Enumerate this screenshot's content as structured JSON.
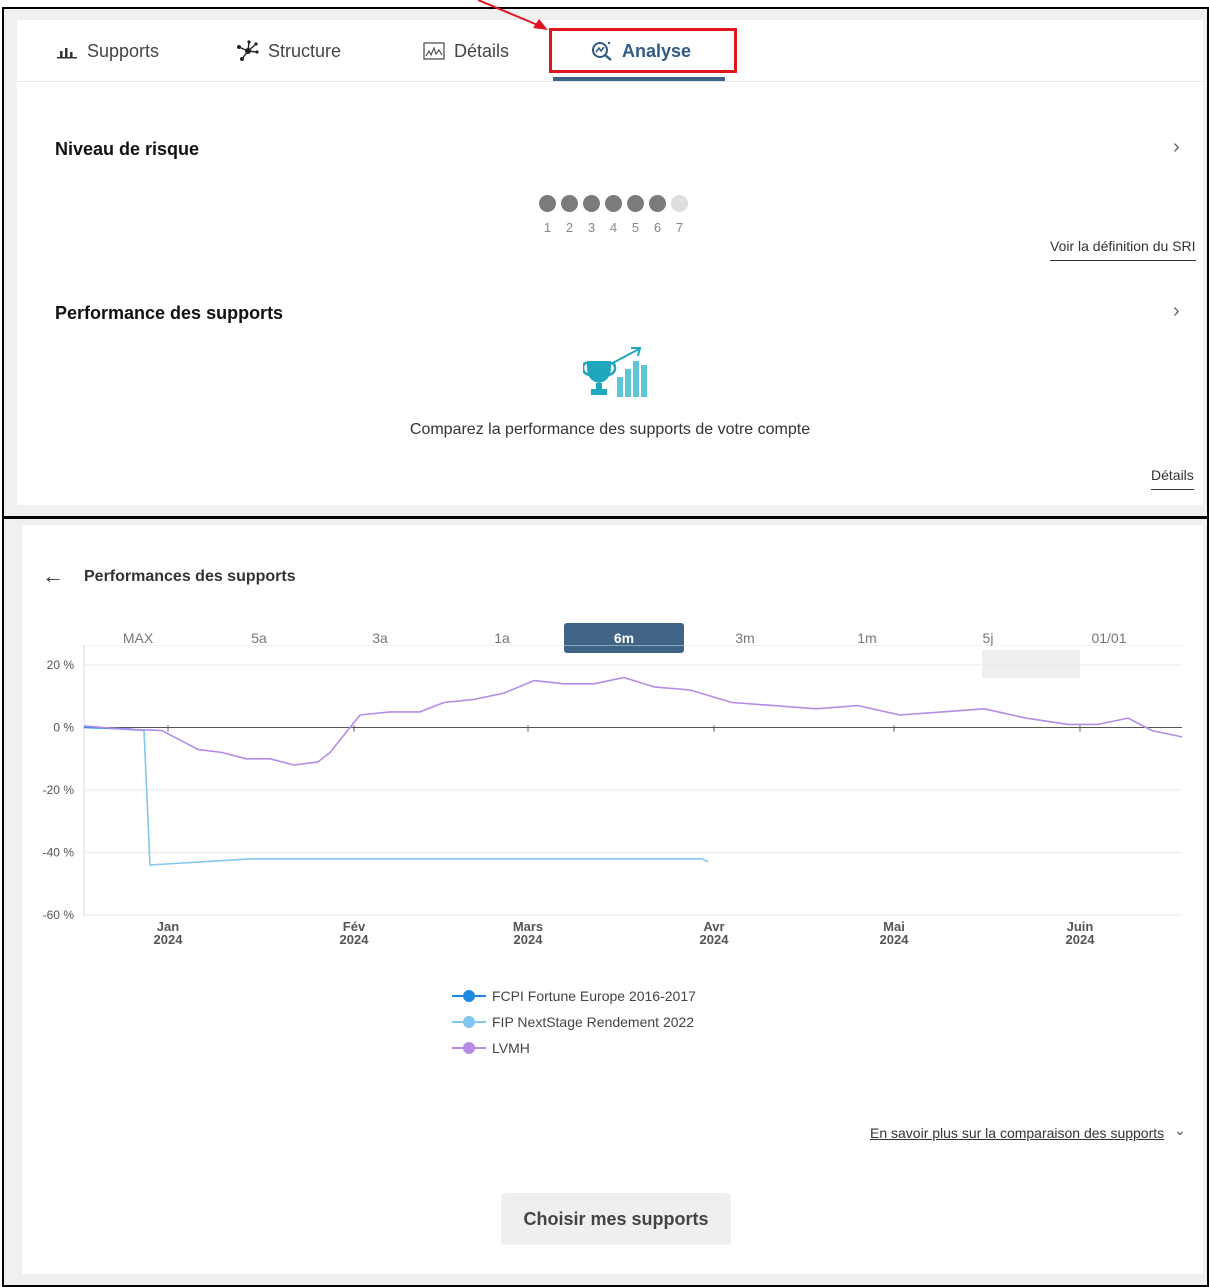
{
  "tabs": [
    {
      "label": "Supports",
      "icon": "bar-chart-icon"
    },
    {
      "label": "Structure",
      "icon": "network-icon"
    },
    {
      "label": "Détails",
      "icon": "line-chart-icon"
    },
    {
      "label": "Analyse",
      "icon": "analysis-icon"
    }
  ],
  "active_tab": "Analyse",
  "risk": {
    "title": "Niveau de risque",
    "scale": [
      "1",
      "2",
      "3",
      "4",
      "5",
      "6",
      "7"
    ],
    "level": 6,
    "sri_link": "Voir la définition du SRI"
  },
  "performance": {
    "title": "Performance des supports",
    "caption": "Comparez la performance des supports de votre compte",
    "details_link": "Détails"
  },
  "panel": {
    "title": "Performances des supports",
    "periods": [
      "MAX",
      "5a",
      "3a",
      "1a",
      "6m",
      "3m",
      "1m",
      "5j",
      "01/01"
    ],
    "active_period": "6m",
    "more_link": "En savoir plus sur la comparaison des supports",
    "choose_button": "Choisir mes supports"
  },
  "colors": {
    "accent": "#3f6486",
    "highlight": "#e0161e",
    "series_fcpi": "#1e88e5",
    "series_fip": "#81c7ef",
    "series_lvmh": "#b58be6"
  },
  "chart_data": {
    "type": "line",
    "ylim": [
      -60,
      20
    ],
    "yticks": [
      20,
      0,
      -20,
      -40,
      -60
    ],
    "ytick_labels": [
      "20 %",
      "0 %",
      "-20 %",
      "-40 %",
      "-60 %"
    ],
    "xticks": [
      {
        "date": "2024-01-01",
        "label1": "Jan",
        "label2": "2024"
      },
      {
        "date": "2024-02-01",
        "label1": "Fév",
        "label2": "2024"
      },
      {
        "date": "2024-03-01",
        "label1": "Mars",
        "label2": "2024"
      },
      {
        "date": "2024-04-01",
        "label1": "Avr",
        "label2": "2024"
      },
      {
        "date": "2024-05-01",
        "label1": "Mai",
        "label2": "2024"
      },
      {
        "date": "2024-06-01",
        "label1": "Juin",
        "label2": "2024"
      }
    ],
    "xlim": [
      "2023-12-18",
      "2024-06-18"
    ],
    "series": [
      {
        "name": "FCPI Fortune Europe 2016-2017",
        "color": "#1e88e5",
        "x": [
          "2023-12-18",
          "2023-12-26"
        ],
        "y": [
          0,
          -0.5
        ]
      },
      {
        "name": "FIP NextStage Rendement 2022",
        "color": "#81c7ef",
        "x": [
          "2023-12-18",
          "2023-12-21",
          "2023-12-24",
          "2023-12-28",
          "2023-12-29",
          "2024-01-15",
          "2024-02-15",
          "2024-03-15",
          "2024-03-30",
          "2024-03-31"
        ],
        "y": [
          0.5,
          0,
          -0.5,
          -1,
          -44,
          -42,
          -42,
          -42,
          -42,
          -43
        ]
      },
      {
        "name": "LVMH",
        "color": "#b58be6",
        "x": [
          "2023-12-18",
          "2023-12-21",
          "2023-12-25",
          "2023-12-31",
          "2024-01-02",
          "2024-01-06",
          "2024-01-10",
          "2024-01-14",
          "2024-01-18",
          "2024-01-22",
          "2024-01-26",
          "2024-01-28",
          "2024-02-02",
          "2024-02-07",
          "2024-02-12",
          "2024-02-16",
          "2024-02-21",
          "2024-02-26",
          "2024-03-02",
          "2024-03-07",
          "2024-03-12",
          "2024-03-17",
          "2024-03-22",
          "2024-03-28",
          "2024-04-04",
          "2024-04-11",
          "2024-04-18",
          "2024-04-25",
          "2024-05-02",
          "2024-05-09",
          "2024-05-16",
          "2024-05-23",
          "2024-05-30",
          "2024-06-04",
          "2024-06-09",
          "2024-06-13",
          "2024-06-18"
        ],
        "y": [
          0.5,
          0,
          -0.5,
          -1,
          -3,
          -7,
          -8,
          -10,
          -10,
          -12,
          -11,
          -8,
          4,
          5,
          5,
          8,
          9,
          11,
          15,
          14,
          14,
          16,
          13,
          12,
          8,
          7,
          6,
          7,
          4,
          5,
          6,
          3,
          1,
          1,
          3,
          -1,
          -3
        ]
      }
    ]
  }
}
